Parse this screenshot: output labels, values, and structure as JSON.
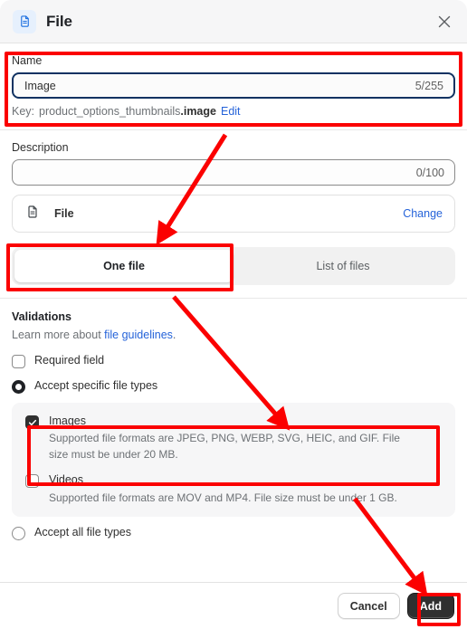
{
  "header": {
    "title": "File",
    "icon": "file-document-icon",
    "close_icon": "close-icon"
  },
  "name_section": {
    "label": "Name",
    "value": "Image",
    "placeholder": "Name",
    "counter": "5/255",
    "key_label": "Key:",
    "key_prefix": "product_options_thumbnails",
    "key_suffix": ".image",
    "edit_link": "Edit"
  },
  "description_section": {
    "label": "Description",
    "value": "",
    "placeholder": "",
    "counter": "0/100"
  },
  "file_card": {
    "icon": "file-document-icon",
    "name": "File",
    "change_label": "Change"
  },
  "tabs": [
    {
      "label": "One file",
      "active": true
    },
    {
      "label": "List of files",
      "active": false
    }
  ],
  "validations": {
    "title": "Validations",
    "learn_more_prefix": "Learn more about ",
    "learn_more_link": "file guidelines",
    "learn_more_suffix": ".",
    "required_field": {
      "label": "Required field",
      "checked": false
    },
    "accept_specific": {
      "label": "Accept specific file types",
      "selected": true
    },
    "accept_all": {
      "label": "Accept all file types",
      "selected": false
    },
    "types": [
      {
        "name": "Images",
        "checked": true,
        "description": "Supported file formats are JPEG, PNG, WEBP, SVG, HEIC, and GIF. File size must be under 20 MB."
      },
      {
        "name": "Videos",
        "checked": false,
        "description": "Supported file formats are MOV and MP4. File size must be under 1 GB."
      }
    ]
  },
  "footer": {
    "cancel_label": "Cancel",
    "add_label": "Add"
  },
  "colors": {
    "annotation": "#fb0000",
    "link": "#2563d9",
    "primary_button": "#303030",
    "focus_border": "#103262",
    "header_bg": "#f6f6f7"
  }
}
